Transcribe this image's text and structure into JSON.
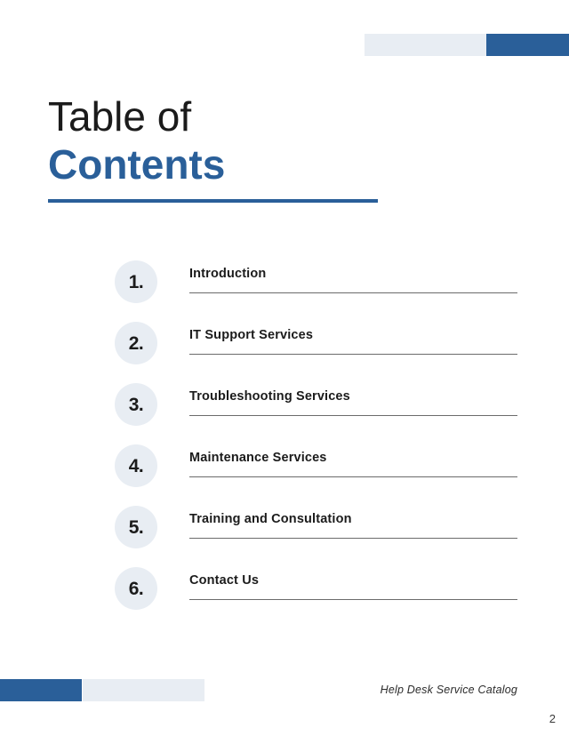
{
  "document": {
    "title_line1": "Table of",
    "title_line2": "Contents"
  },
  "colors": {
    "accent_blue": "#2A5F99",
    "badge_fill": "#E8EDF3",
    "rule_gray": "#6b6b6b",
    "text_dark": "#1b1b1b"
  },
  "toc": {
    "items": [
      {
        "number": "1.",
        "label": "Introduction"
      },
      {
        "number": "2.",
        "label": "IT Support Services"
      },
      {
        "number": "3.",
        "label": "Troubleshooting Services"
      },
      {
        "number": "4.",
        "label": "Maintenance Services"
      },
      {
        "number": "5.",
        "label": "Training and Consultation"
      },
      {
        "number": "6.",
        "label": "Contact Us"
      }
    ]
  },
  "footer": {
    "caption": "Help Desk Service Catalog",
    "page_number": "2"
  }
}
